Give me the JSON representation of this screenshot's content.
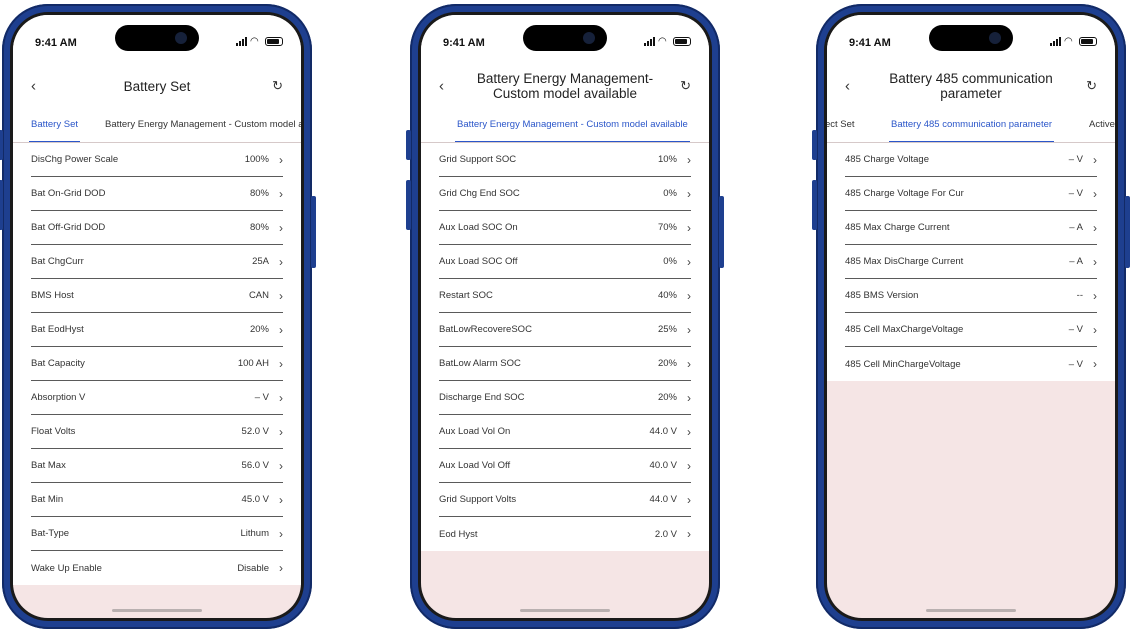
{
  "status": {
    "time": "9:41 AM"
  },
  "nav_icons": {
    "back": "chevron-left-icon",
    "refresh": "refresh-icon"
  },
  "phones": [
    {
      "title": "Battery Set",
      "tabs": [
        {
          "label": "Battery Set",
          "active": true
        },
        {
          "label": "Battery Energy Management - Custom model ava",
          "active": false
        }
      ],
      "rows": [
        {
          "label": "DisChg Power Scale",
          "value": "100%"
        },
        {
          "label": "Bat On-Grid DOD",
          "value": "80%"
        },
        {
          "label": "Bat Off-Grid DOD",
          "value": "80%"
        },
        {
          "label": "Bat ChgCurr",
          "value": "25A"
        },
        {
          "label": "BMS Host",
          "value": "CAN"
        },
        {
          "label": "Bat EodHyst",
          "value": "20%"
        },
        {
          "label": "Bat Capacity",
          "value": "100 AH"
        },
        {
          "label": "Absorption V",
          "value": "– V"
        },
        {
          "label": "Float Volts",
          "value": "52.0 V"
        },
        {
          "label": "Bat Max",
          "value": "56.0 V"
        },
        {
          "label": "Bat Min",
          "value": "45.0 V"
        },
        {
          "label": "Bat-Type",
          "value": "Lithum"
        },
        {
          "label": "Wake Up Enable",
          "value": "Disable"
        }
      ]
    },
    {
      "title": "Battery Energy Management-Custom model available",
      "tabs": [
        {
          "label": "Battery Energy Management - Custom model available",
          "active": true
        }
      ],
      "rows": [
        {
          "label": "Grid Support SOC",
          "value": "10%"
        },
        {
          "label": "Grid Chg End SOC",
          "value": "0%"
        },
        {
          "label": "Aux Load SOC On",
          "value": "70%"
        },
        {
          "label": "Aux Load SOC Off",
          "value": "0%"
        },
        {
          "label": "Restart SOC",
          "value": "40%"
        },
        {
          "label": "BatLowRecovereSOC",
          "value": "25%"
        },
        {
          "label": "BatLow Alarm SOC",
          "value": "20%"
        },
        {
          "label": "Discharge End SOC",
          "value": "20%"
        },
        {
          "label": "Aux Load Vol On",
          "value": "44.0 V"
        },
        {
          "label": "Aux Load Vol Off",
          "value": "40.0 V"
        },
        {
          "label": "Grid Support Volts",
          "value": "44.0 V"
        },
        {
          "label": "Eod Hyst",
          "value": "2.0 V"
        }
      ]
    },
    {
      "title": "Battery 485 communication parameter",
      "tabs": [
        {
          "label": "ect Set",
          "active": false
        },
        {
          "label": "Battery 485 communication parameter",
          "active": true
        },
        {
          "label": "Active",
          "active": false
        }
      ],
      "rows": [
        {
          "label": "485 Charge Voltage",
          "value": "– V"
        },
        {
          "label": "485 Charge Voltage For Cur",
          "value": "– V"
        },
        {
          "label": "485 Max Charge Current",
          "value": "– A"
        },
        {
          "label": "485 Max DisCharge Current",
          "value": "– A"
        },
        {
          "label": "485 BMS Version",
          "value": "--"
        },
        {
          "label": "485 Cell MaxChargeVoltage",
          "value": "– V"
        },
        {
          "label": "485 Cell MinChargeVoltage",
          "value": "– V"
        }
      ]
    }
  ]
}
